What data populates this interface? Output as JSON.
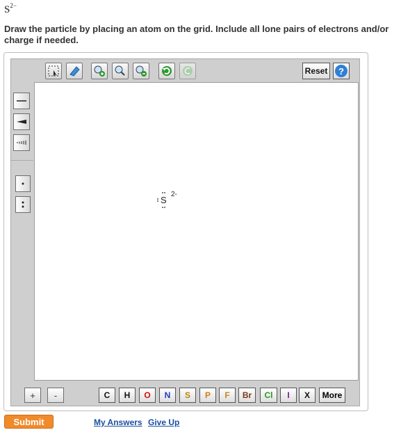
{
  "question": {
    "formula_symbol": "S",
    "formula_charge": "2−",
    "instruction": "Draw the particle by placing an atom on the grid. Include all lone pairs of electrons and/or charge if needed."
  },
  "toolbar": {
    "reset_label": "Reset",
    "help_label": "?"
  },
  "canvas": {
    "atom_symbol": "S",
    "atom_charge": "2-"
  },
  "charge_buttons": {
    "plus": "+",
    "minus": "-"
  },
  "elements": [
    {
      "symbol": "C",
      "color": "#111111"
    },
    {
      "symbol": "H",
      "color": "#111111"
    },
    {
      "symbol": "O",
      "color": "#d01010"
    },
    {
      "symbol": "N",
      "color": "#1f3fbf"
    },
    {
      "symbol": "S",
      "color": "#b8860b"
    },
    {
      "symbol": "P",
      "color": "#d27d1a"
    },
    {
      "symbol": "F",
      "color": "#c08a20"
    },
    {
      "symbol": "Br",
      "color": "#7a3a1a"
    },
    {
      "symbol": "Cl",
      "color": "#2a9a2a"
    },
    {
      "symbol": "I",
      "color": "#7a1a9a"
    },
    {
      "symbol": "X",
      "color": "#111111"
    }
  ],
  "more_label": "More",
  "actions": {
    "submit": "Submit",
    "my_answers": "My Answers",
    "give_up": "Give Up"
  }
}
